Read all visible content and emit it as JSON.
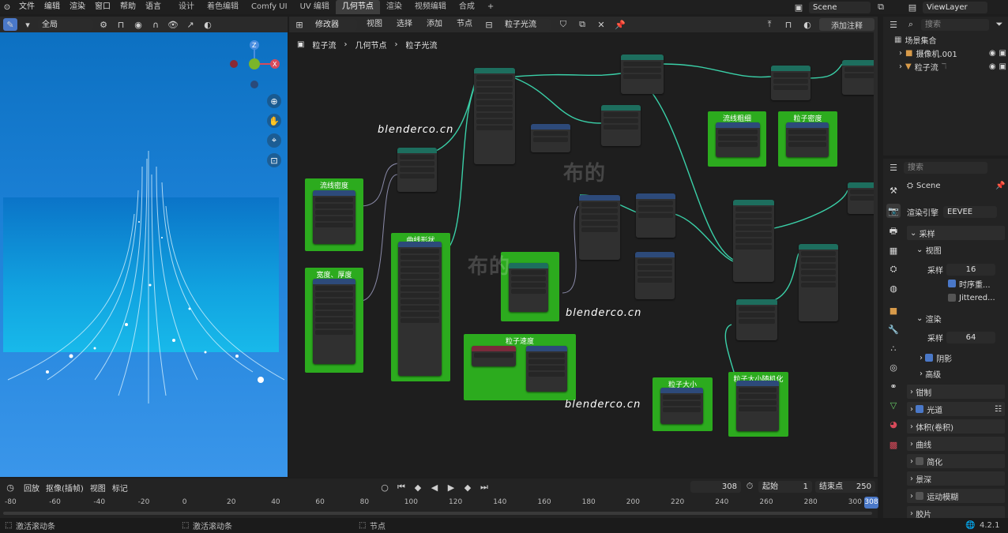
{
  "app": {
    "menu": [
      "文件",
      "编辑",
      "渲染",
      "窗口",
      "帮助",
      "语言"
    ],
    "workspaces": [
      {
        "label": "设计",
        "active": false
      },
      {
        "label": "着色编辑",
        "active": false
      },
      {
        "label": "Comfy UI",
        "active": false
      },
      {
        "label": "UV 编辑",
        "active": false
      },
      {
        "label": "几何节点",
        "active": true
      },
      {
        "label": "渲染",
        "active": false
      },
      {
        "label": "视频编辑",
        "active": false
      },
      {
        "label": "合成",
        "active": false
      }
    ],
    "scene": "Scene",
    "view_layer": "ViewLayer"
  },
  "viewport": {
    "view_mode": "全局"
  },
  "node_editor": {
    "modifier_mode": "修改器",
    "menus": [
      "视图",
      "选择",
      "添加",
      "节点"
    ],
    "node_tree": "粒子光流",
    "add_annotation": "添加注释",
    "breadcrumb": [
      "粒子流",
      "几何节点",
      "粒子光流"
    ],
    "frames": [
      "流线密度",
      "宽度、厚度",
      "曲线形状",
      "粒子速度",
      "流线粗细",
      "粒子密度",
      "粒子大小",
      "粒子大小随机化"
    ],
    "watermarks": [
      "blenderco.cn",
      "blenderco.cn",
      "blenderco.cn"
    ],
    "wm_cn": [
      "布的",
      "布的"
    ]
  },
  "outliner": {
    "search_placeholder": "搜索",
    "scene_collection": "场景集合",
    "items": [
      "摄像机.001",
      "粒子流"
    ]
  },
  "properties": {
    "search_placeholder": "搜索",
    "scene": "Scene",
    "render_engine_label": "渲染引擎",
    "render_engine": "EEVEE",
    "sampling": "采样",
    "viewport": "视图",
    "samples_label": "采样",
    "viewport_samples": "16",
    "temporal_reprojection": "时序重...",
    "jittered": "Jittered...",
    "render": "渲染",
    "render_samples": "64",
    "shadows": "阴影",
    "advanced": "高级",
    "sections": [
      "钳制",
      "光道",
      "体积(卷积)",
      "曲线",
      "简化",
      "景深",
      "运动模糊",
      "胶片"
    ]
  },
  "timeline": {
    "playback": "回放",
    "keying": "抠像(插帧)",
    "view": "视图",
    "marker": "标记",
    "current_frame": "308",
    "start_label": "起始",
    "start": "1",
    "end_label": "结束点",
    "end": "250",
    "ruler": [
      "-80",
      "-60",
      "-40",
      "-20",
      "0",
      "20",
      "40",
      "60",
      "80",
      "100",
      "120",
      "140",
      "160",
      "180",
      "200",
      "220",
      "240",
      "260",
      "280",
      "300"
    ],
    "playhead": "308"
  },
  "status": {
    "left": "激活滚动条",
    "mid": "激活滚动条",
    "right": "节点",
    "version": "4.2.1"
  }
}
